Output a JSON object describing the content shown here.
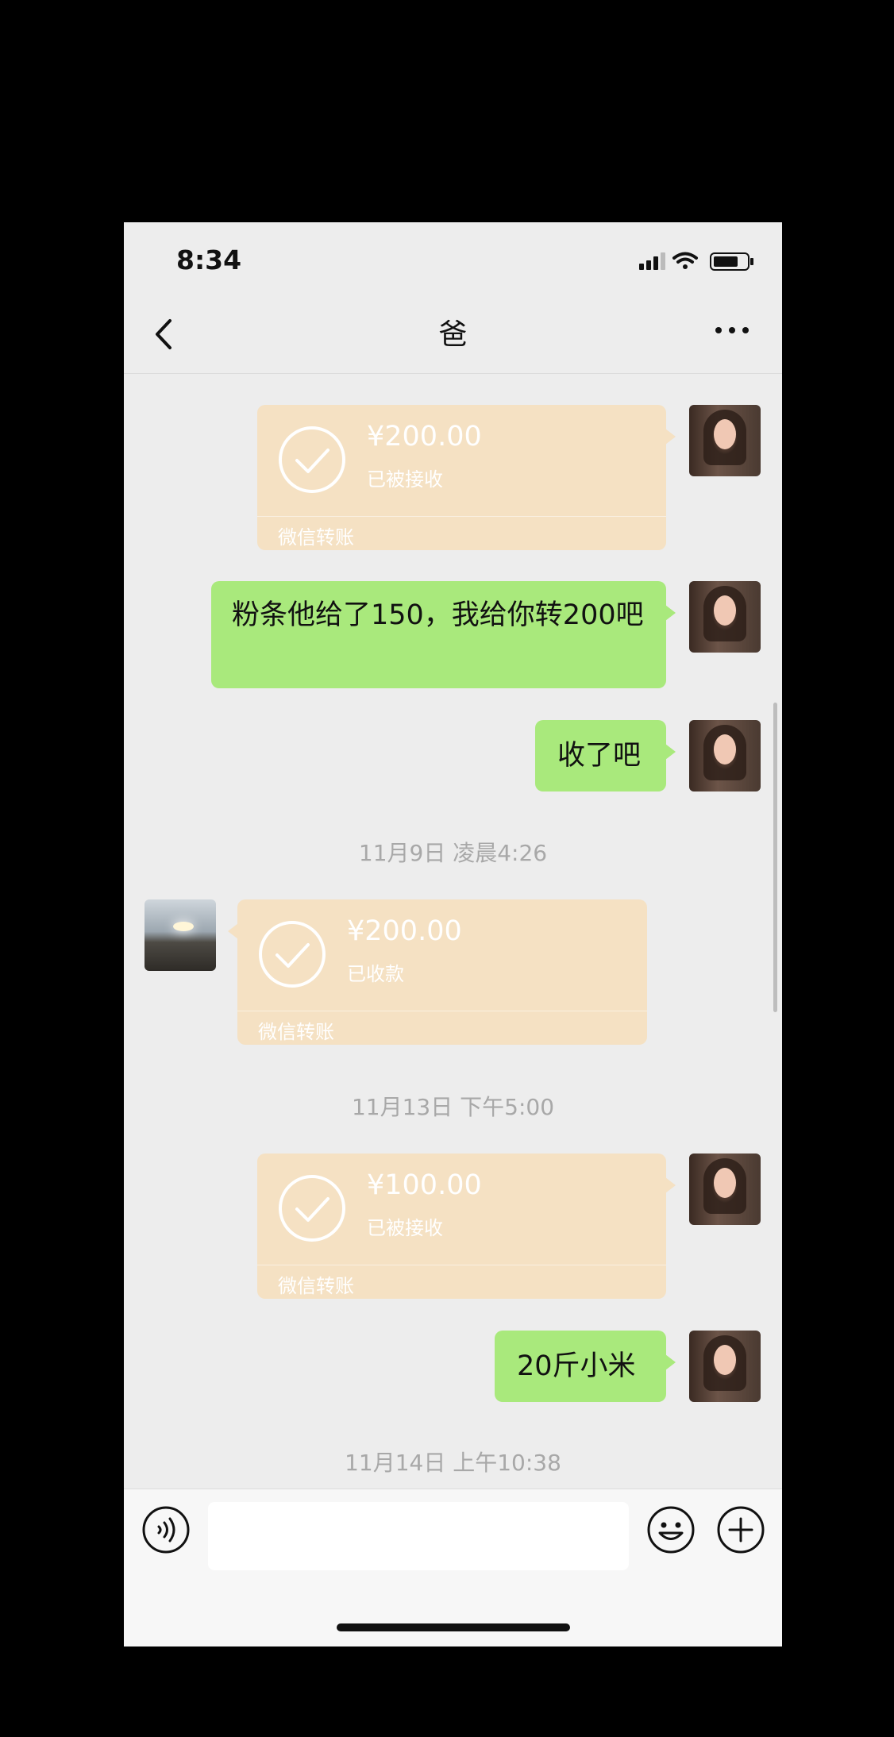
{
  "status_bar": {
    "time": "8:34"
  },
  "nav": {
    "title": "爸"
  },
  "messages": {
    "m1": {
      "amount": "¥200.00",
      "status": "已被接收",
      "label": "微信转账"
    },
    "m2": {
      "text": "粉条他给了150，我给你转200吧"
    },
    "m3": {
      "text": "收了吧"
    },
    "ts1": "11月9日 凌晨4:26",
    "m4": {
      "amount": "¥200.00",
      "status": "已收款",
      "label": "微信转账"
    },
    "ts2": "11月13日 下午5:00",
    "m5": {
      "amount": "¥100.00",
      "status": "已被接收",
      "label": "微信转账"
    },
    "m6": {
      "text": "20斤小米"
    },
    "ts3": "11月14日 上午10:38"
  },
  "input": {
    "value": ""
  },
  "colors": {
    "bubble_green": "#a9e97c",
    "transfer_bg": "#f5e1c3",
    "background": "#ededed"
  },
  "icons": [
    "signal-icon",
    "wifi-icon",
    "battery-icon",
    "back-icon",
    "more-icon",
    "check-icon",
    "voice-icon",
    "emoji-icon",
    "plus-icon"
  ]
}
